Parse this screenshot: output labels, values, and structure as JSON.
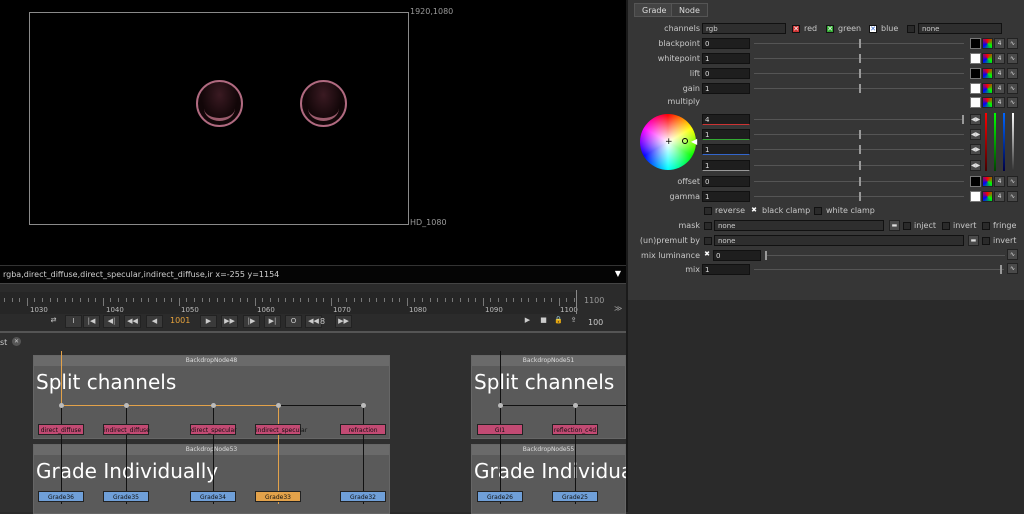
{
  "viewer": {
    "format_top_right": "1920,1080",
    "format_bottom_right": "HD_1080",
    "info_bar": "rgba,direct_diffuse,direct_specular,indirect_diffuse,ir  x=-255 y=1154"
  },
  "timeline": {
    "ticks": [
      "1030",
      "1040",
      "1050",
      "1060",
      "1070",
      "1080",
      "1090",
      "1100"
    ],
    "end_frame": "1100",
    "current_frame": "1001",
    "step": "8",
    "fps": "100"
  },
  "graph": {
    "tab_label": "st",
    "left_backdrops": [
      {
        "title": "BackdropNode48",
        "label": "Split channels"
      },
      {
        "title": "BackdropNode53",
        "label": "Grade Individually"
      }
    ],
    "right_backdrops": [
      {
        "title": "BackdropNode51",
        "label": "Split channels"
      },
      {
        "title": "BackdropNode55",
        "label": "Grade Individua"
      }
    ],
    "shuffle_nodes_left": [
      "direct_diffuse",
      "indirect_diffuse",
      "direct_specular",
      "indirect_specular",
      "refraction"
    ],
    "grade_nodes_left": [
      "Grade36",
      "Grade35",
      "Grade34",
      "Grade33",
      "Grade32"
    ],
    "shuffle_nodes_right": [
      "GI1",
      "reflection_c4d"
    ],
    "grade_nodes_right": [
      "Grade26",
      "Grade25"
    ]
  },
  "props": {
    "tabs": [
      "Grade",
      "Node"
    ],
    "channels_label": "channels",
    "channels_value": "rgb",
    "red": "red",
    "green": "green",
    "blue": "blue",
    "none": "none",
    "params": [
      {
        "label": "blackpoint",
        "value": "0"
      },
      {
        "label": "whitepoint",
        "value": "1"
      },
      {
        "label": "lift",
        "value": "0"
      },
      {
        "label": "gain",
        "value": "1"
      }
    ],
    "multiply_label": "multiply",
    "multiply_values": [
      "4",
      "1",
      "1",
      "1"
    ],
    "offset_label": "offset",
    "offset_value": "0",
    "gamma_label": "gamma",
    "gamma_value": "1",
    "reverse": "reverse",
    "black_clamp": "black clamp",
    "white_clamp": "white clamp",
    "mask_label": "mask",
    "mask_value": "none",
    "inject": "inject",
    "invert": "invert",
    "fringe": "fringe",
    "unpremult_label": "(un)premult by",
    "unpremult_value": "none",
    "invert2": "invert",
    "mix_luminance_label": "mix luminance",
    "mix_luminance_value": "0",
    "mix_label": "mix",
    "mix_value": "1",
    "count_badge": "4"
  },
  "colors": {
    "shuffle_node": "#c24a73",
    "grade_node": "#6f9fd8",
    "selected_node": "#e3a24a",
    "sphere_rim": "#b06a80"
  }
}
